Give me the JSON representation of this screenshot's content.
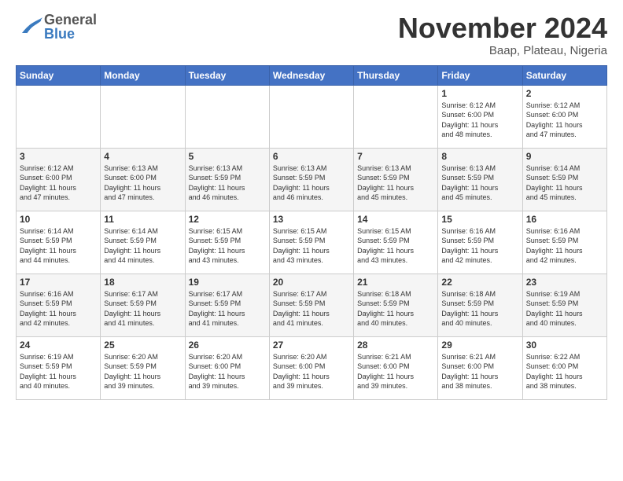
{
  "header": {
    "logo_general": "General",
    "logo_blue": "Blue",
    "month": "November 2024",
    "location": "Baap, Plateau, Nigeria"
  },
  "weekdays": [
    "Sunday",
    "Monday",
    "Tuesday",
    "Wednesday",
    "Thursday",
    "Friday",
    "Saturday"
  ],
  "weeks": [
    [
      {
        "day": "",
        "info": ""
      },
      {
        "day": "",
        "info": ""
      },
      {
        "day": "",
        "info": ""
      },
      {
        "day": "",
        "info": ""
      },
      {
        "day": "",
        "info": ""
      },
      {
        "day": "1",
        "info": "Sunrise: 6:12 AM\nSunset: 6:00 PM\nDaylight: 11 hours\nand 48 minutes."
      },
      {
        "day": "2",
        "info": "Sunrise: 6:12 AM\nSunset: 6:00 PM\nDaylight: 11 hours\nand 47 minutes."
      }
    ],
    [
      {
        "day": "3",
        "info": "Sunrise: 6:12 AM\nSunset: 6:00 PM\nDaylight: 11 hours\nand 47 minutes."
      },
      {
        "day": "4",
        "info": "Sunrise: 6:13 AM\nSunset: 6:00 PM\nDaylight: 11 hours\nand 47 minutes."
      },
      {
        "day": "5",
        "info": "Sunrise: 6:13 AM\nSunset: 5:59 PM\nDaylight: 11 hours\nand 46 minutes."
      },
      {
        "day": "6",
        "info": "Sunrise: 6:13 AM\nSunset: 5:59 PM\nDaylight: 11 hours\nand 46 minutes."
      },
      {
        "day": "7",
        "info": "Sunrise: 6:13 AM\nSunset: 5:59 PM\nDaylight: 11 hours\nand 45 minutes."
      },
      {
        "day": "8",
        "info": "Sunrise: 6:13 AM\nSunset: 5:59 PM\nDaylight: 11 hours\nand 45 minutes."
      },
      {
        "day": "9",
        "info": "Sunrise: 6:14 AM\nSunset: 5:59 PM\nDaylight: 11 hours\nand 45 minutes."
      }
    ],
    [
      {
        "day": "10",
        "info": "Sunrise: 6:14 AM\nSunset: 5:59 PM\nDaylight: 11 hours\nand 44 minutes."
      },
      {
        "day": "11",
        "info": "Sunrise: 6:14 AM\nSunset: 5:59 PM\nDaylight: 11 hours\nand 44 minutes."
      },
      {
        "day": "12",
        "info": "Sunrise: 6:15 AM\nSunset: 5:59 PM\nDaylight: 11 hours\nand 43 minutes."
      },
      {
        "day": "13",
        "info": "Sunrise: 6:15 AM\nSunset: 5:59 PM\nDaylight: 11 hours\nand 43 minutes."
      },
      {
        "day": "14",
        "info": "Sunrise: 6:15 AM\nSunset: 5:59 PM\nDaylight: 11 hours\nand 43 minutes."
      },
      {
        "day": "15",
        "info": "Sunrise: 6:16 AM\nSunset: 5:59 PM\nDaylight: 11 hours\nand 42 minutes."
      },
      {
        "day": "16",
        "info": "Sunrise: 6:16 AM\nSunset: 5:59 PM\nDaylight: 11 hours\nand 42 minutes."
      }
    ],
    [
      {
        "day": "17",
        "info": "Sunrise: 6:16 AM\nSunset: 5:59 PM\nDaylight: 11 hours\nand 42 minutes."
      },
      {
        "day": "18",
        "info": "Sunrise: 6:17 AM\nSunset: 5:59 PM\nDaylight: 11 hours\nand 41 minutes."
      },
      {
        "day": "19",
        "info": "Sunrise: 6:17 AM\nSunset: 5:59 PM\nDaylight: 11 hours\nand 41 minutes."
      },
      {
        "day": "20",
        "info": "Sunrise: 6:17 AM\nSunset: 5:59 PM\nDaylight: 11 hours\nand 41 minutes."
      },
      {
        "day": "21",
        "info": "Sunrise: 6:18 AM\nSunset: 5:59 PM\nDaylight: 11 hours\nand 40 minutes."
      },
      {
        "day": "22",
        "info": "Sunrise: 6:18 AM\nSunset: 5:59 PM\nDaylight: 11 hours\nand 40 minutes."
      },
      {
        "day": "23",
        "info": "Sunrise: 6:19 AM\nSunset: 5:59 PM\nDaylight: 11 hours\nand 40 minutes."
      }
    ],
    [
      {
        "day": "24",
        "info": "Sunrise: 6:19 AM\nSunset: 5:59 PM\nDaylight: 11 hours\nand 40 minutes."
      },
      {
        "day": "25",
        "info": "Sunrise: 6:20 AM\nSunset: 5:59 PM\nDaylight: 11 hours\nand 39 minutes."
      },
      {
        "day": "26",
        "info": "Sunrise: 6:20 AM\nSunset: 6:00 PM\nDaylight: 11 hours\nand 39 minutes."
      },
      {
        "day": "27",
        "info": "Sunrise: 6:20 AM\nSunset: 6:00 PM\nDaylight: 11 hours\nand 39 minutes."
      },
      {
        "day": "28",
        "info": "Sunrise: 6:21 AM\nSunset: 6:00 PM\nDaylight: 11 hours\nand 39 minutes."
      },
      {
        "day": "29",
        "info": "Sunrise: 6:21 AM\nSunset: 6:00 PM\nDaylight: 11 hours\nand 38 minutes."
      },
      {
        "day": "30",
        "info": "Sunrise: 6:22 AM\nSunset: 6:00 PM\nDaylight: 11 hours\nand 38 minutes."
      }
    ]
  ]
}
